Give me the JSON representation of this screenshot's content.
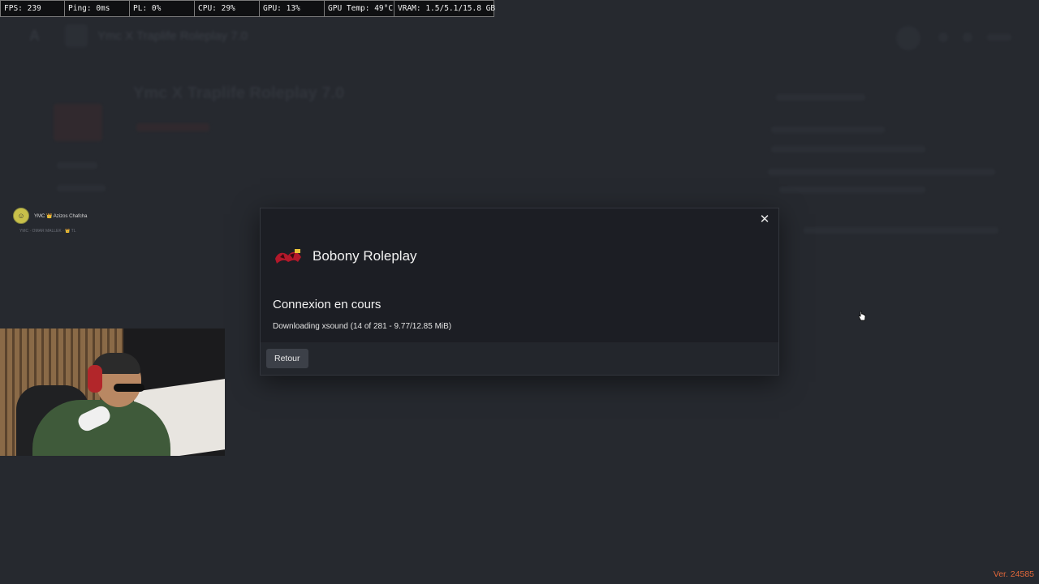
{
  "stats": [
    {
      "label": "FPS: 239"
    },
    {
      "label": "Ping: 0ms"
    },
    {
      "label": "PL: 0%"
    },
    {
      "label": "CPU: 29%"
    },
    {
      "label": "GPU: 13%"
    },
    {
      "label": "GPU Temp: 49°C"
    },
    {
      "label": "VRAM: 1.5/5.1/15.8 GB"
    }
  ],
  "background": {
    "topbar_title": "Ymc X Traplife Roleplay 7.0",
    "page_title": "Ymc X Traplife Roleplay 7.0"
  },
  "chat": {
    "name": "YMC 👑 Azizos Chafcha",
    "sub": "YMC · OMAR MALLEK · 👑 TL"
  },
  "modal": {
    "server_name": "Bobony Roleplay",
    "status_title": "Connexion en cours",
    "status_detail": "Downloading xsound (14 of 281 - 9.77/12.85 MiB)",
    "back_label": "Retour",
    "close_glyph": "✕"
  },
  "version": "Ver. 24585",
  "colors": {
    "background": "#26292f",
    "modal": "#1c1e24",
    "modal_footer": "#23262c",
    "version": "#e0673a"
  }
}
